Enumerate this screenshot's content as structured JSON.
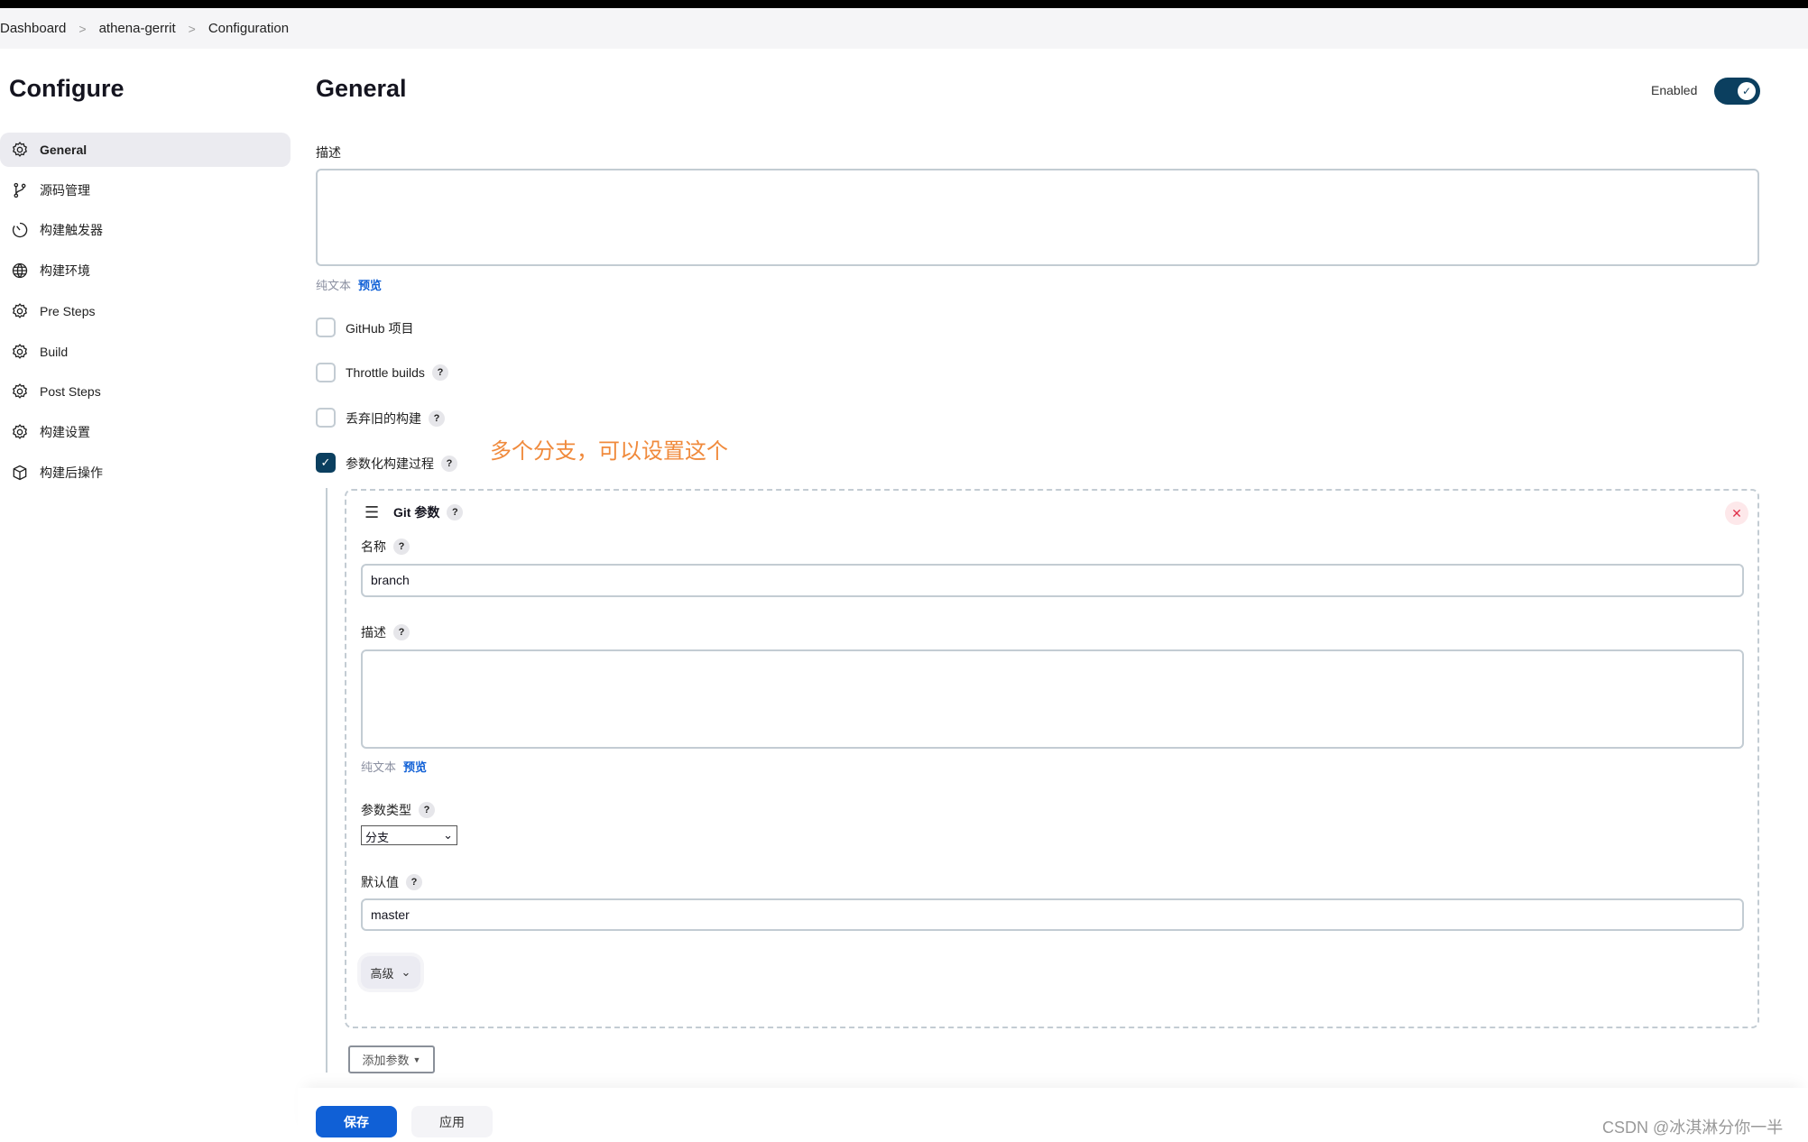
{
  "breadcrumb": [
    "Dashboard",
    "athena-gerrit",
    "Configuration"
  ],
  "sidebar": {
    "title": "Configure",
    "items": [
      {
        "label": "General",
        "icon": "gear-icon",
        "active": true
      },
      {
        "label": "源码管理",
        "icon": "branch-icon"
      },
      {
        "label": "构建触发器",
        "icon": "timer-icon"
      },
      {
        "label": "构建环境",
        "icon": "globe-icon"
      },
      {
        "label": "Pre Steps",
        "icon": "gear-icon"
      },
      {
        "label": "Build",
        "icon": "gear-icon"
      },
      {
        "label": "Post Steps",
        "icon": "gear-icon"
      },
      {
        "label": "构建设置",
        "icon": "gear-icon"
      },
      {
        "label": "构建后操作",
        "icon": "package-icon"
      }
    ]
  },
  "main": {
    "title": "General",
    "enabled_label": "Enabled",
    "enabled": true,
    "description_label": "描述",
    "description_value": "",
    "format": {
      "plain": "纯文本",
      "preview": "预览"
    },
    "options": [
      {
        "label": "GitHub 项目",
        "checked": false,
        "help": false
      },
      {
        "label": "Throttle builds",
        "checked": false,
        "help": true
      },
      {
        "label": "丢弃旧的构建",
        "checked": false,
        "help": true
      },
      {
        "label": "参数化构建过程",
        "checked": true,
        "help": true
      }
    ],
    "annotation": "多个分支，可以设置这个",
    "git_param": {
      "title": "Git 参数",
      "name_label": "名称",
      "name_value": "branch",
      "desc_label": "描述",
      "desc_value": "",
      "type_label": "参数类型",
      "type_value": "分支",
      "default_label": "默认值",
      "default_value": "master",
      "advanced": "高级"
    },
    "add_param": "添加参数",
    "save": "保存",
    "apply": "应用"
  },
  "watermark": "CSDN @冰淇淋分你一半",
  "colors": {
    "accent": "#0b3f5f",
    "primary_button": "#1060d6",
    "annotation": "#f08a3c"
  }
}
